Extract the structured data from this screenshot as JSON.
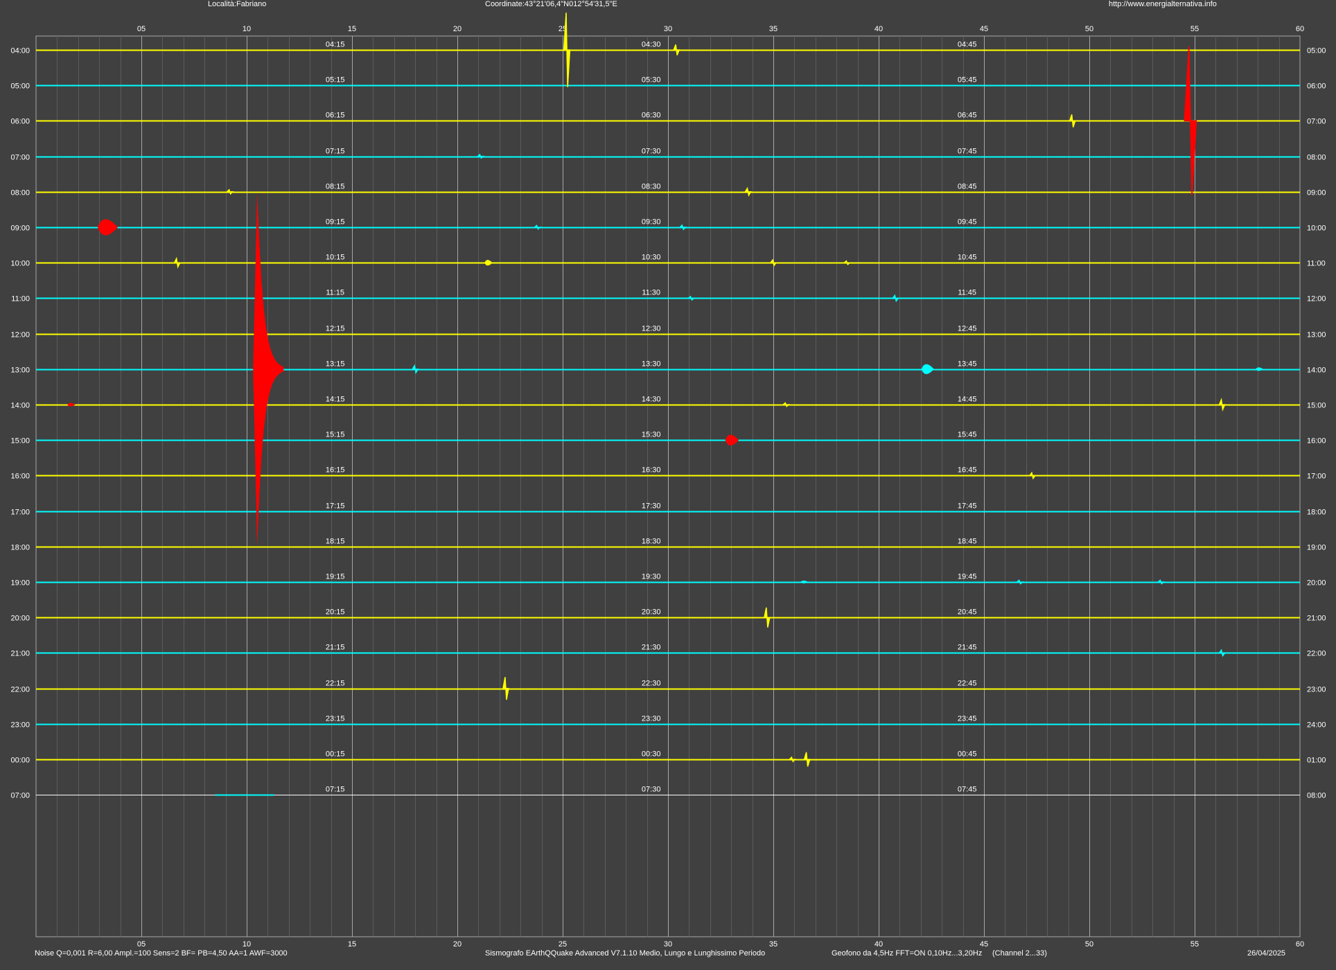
{
  "header": {
    "location": "Località:Fabriano",
    "coordinates": "Coordinate:43°21'06,4\"N012°54'31,5\"E",
    "url": "http://www.energialternativa.info"
  },
  "footer": {
    "noise": "Noise Q=0,001 R=6,00 Ampl.=100 Sens=2 BF= PB=4,50 AA=1 AWF=3000",
    "software": "Sismografo  EArthQQuake Advanced V7.1.10  Medio, Lungo e Lunghissimo Periodo",
    "geophone": "Geofono da 4,5Hz FFT=ON 0,10Hz...3,20Hz",
    "channel": "(Channel 2...33)",
    "date": "26/04/2025"
  },
  "colors": {
    "background": "#404040",
    "yellow_trace": "#ffff00",
    "cyan_trace": "#00ffff",
    "event": "#ff0000",
    "white_trace": "#ffffff",
    "major_grid": "#a8a8a8",
    "minor_grid": "#5c5c5c"
  },
  "chart_data": {
    "type": "line",
    "title": "",
    "x_unit": "minutes",
    "xlim": [
      0,
      60
    ],
    "x_tick_labels": [
      "05",
      "10",
      "15",
      "20",
      "25",
      "30",
      "35",
      "40",
      "45",
      "50",
      "55",
      "60"
    ],
    "grid": true,
    "rows": [
      {
        "left": "04:00",
        "right": "05:00",
        "q": [
          "04:15",
          "04:30",
          "04:45"
        ],
        "color": "yellow"
      },
      {
        "left": "05:00",
        "right": "06:00",
        "q": [
          "05:15",
          "05:30",
          "05:45"
        ],
        "color": "cyan"
      },
      {
        "left": "06:00",
        "right": "07:00",
        "q": [
          "06:15",
          "06:30",
          "06:45"
        ],
        "color": "yellow"
      },
      {
        "left": "07:00",
        "right": "08:00",
        "q": [
          "07:15",
          "07:30",
          "07:45"
        ],
        "color": "cyan"
      },
      {
        "left": "08:00",
        "right": "09:00",
        "q": [
          "08:15",
          "08:30",
          "08:45"
        ],
        "color": "yellow"
      },
      {
        "left": "09:00",
        "right": "10:00",
        "q": [
          "09:15",
          "09:30",
          "09:45"
        ],
        "color": "cyan"
      },
      {
        "left": "10:00",
        "right": "11:00",
        "q": [
          "10:15",
          "10:30",
          "10:45"
        ],
        "color": "yellow"
      },
      {
        "left": "11:00",
        "right": "12:00",
        "q": [
          "11:15",
          "11:30",
          "11:45"
        ],
        "color": "cyan"
      },
      {
        "left": "12:00",
        "right": "13:00",
        "q": [
          "12:15",
          "12:30",
          "12:45"
        ],
        "color": "yellow"
      },
      {
        "left": "13:00",
        "right": "14:00",
        "q": [
          "13:15",
          "13:30",
          "13:45"
        ],
        "color": "cyan"
      },
      {
        "left": "14:00",
        "right": "15:00",
        "q": [
          "14:15",
          "14:30",
          "14:45"
        ],
        "color": "yellow"
      },
      {
        "left": "15:00",
        "right": "16:00",
        "q": [
          "15:15",
          "15:30",
          "15:45"
        ],
        "color": "cyan"
      },
      {
        "left": "16:00",
        "right": "17:00",
        "q": [
          "16:15",
          "16:30",
          "16:45"
        ],
        "color": "yellow"
      },
      {
        "left": "17:00",
        "right": "18:00",
        "q": [
          "17:15",
          "17:30",
          "17:45"
        ],
        "color": "cyan"
      },
      {
        "left": "18:00",
        "right": "19:00",
        "q": [
          "18:15",
          "18:30",
          "18:45"
        ],
        "color": "yellow"
      },
      {
        "left": "19:00",
        "right": "20:00",
        "q": [
          "19:15",
          "19:30",
          "19:45"
        ],
        "color": "cyan"
      },
      {
        "left": "20:00",
        "right": "21:00",
        "q": [
          "20:15",
          "20:30",
          "20:45"
        ],
        "color": "yellow"
      },
      {
        "left": "21:00",
        "right": "22:00",
        "q": [
          "21:15",
          "21:30",
          "21:45"
        ],
        "color": "cyan"
      },
      {
        "left": "22:00",
        "right": "23:00",
        "q": [
          "22:15",
          "22:30",
          "22:45"
        ],
        "color": "yellow"
      },
      {
        "left": "23:00",
        "right": "24:00",
        "q": [
          "23:15",
          "23:30",
          "23:45"
        ],
        "color": "cyan"
      },
      {
        "left": "00:00",
        "right": "01:00",
        "q": [
          "00:15",
          "00:30",
          "00:45"
        ],
        "color": "yellow"
      },
      {
        "left": "07:00",
        "right": "08:00",
        "q": [
          "07:15",
          "07:30",
          "07:45"
        ],
        "color": "white"
      }
    ],
    "events": [
      {
        "row": 0,
        "minute": 25.2,
        "amp": 1.05,
        "color": "yellow",
        "kind": "spike"
      },
      {
        "row": 0,
        "minute": 30.4,
        "amp": 0.15,
        "color": "yellow",
        "kind": "spike"
      },
      {
        "row": 2,
        "minute": 54.8,
        "amp": 2.1,
        "color": "red",
        "kind": "spike"
      },
      {
        "row": 2,
        "minute": 49.2,
        "amp": 0.18,
        "color": "yellow",
        "kind": "spike"
      },
      {
        "row": 3,
        "minute": 21.1,
        "amp": 0.05,
        "color": "cyan",
        "kind": "spike"
      },
      {
        "row": 4,
        "minute": 9.2,
        "amp": 0.06,
        "color": "yellow",
        "kind": "spike"
      },
      {
        "row": 4,
        "minute": 33.8,
        "amp": 0.1,
        "color": "yellow",
        "kind": "spike"
      },
      {
        "row": 5,
        "minute": 3.2,
        "amp": 0.45,
        "color": "red",
        "kind": "burst"
      },
      {
        "row": 5,
        "minute": 23.8,
        "amp": 0.05,
        "color": "cyan",
        "kind": "spike"
      },
      {
        "row": 5,
        "minute": 30.7,
        "amp": 0.06,
        "color": "cyan",
        "kind": "spike"
      },
      {
        "row": 6,
        "minute": 6.7,
        "amp": 0.12,
        "color": "yellow",
        "kind": "spike"
      },
      {
        "row": 6,
        "minute": 21.4,
        "amp": 0.16,
        "color": "yellow",
        "kind": "burst"
      },
      {
        "row": 6,
        "minute": 35.0,
        "amp": 0.08,
        "color": "yellow",
        "kind": "spike"
      },
      {
        "row": 6,
        "minute": 38.5,
        "amp": 0.05,
        "color": "yellow",
        "kind": "spike"
      },
      {
        "row": 7,
        "minute": 31.1,
        "amp": 0.05,
        "color": "cyan",
        "kind": "spike"
      },
      {
        "row": 7,
        "minute": 40.8,
        "amp": 0.08,
        "color": "cyan",
        "kind": "spike"
      },
      {
        "row": 9,
        "minute": 10.5,
        "amp": 5.0,
        "color": "red",
        "kind": "quake"
      },
      {
        "row": 9,
        "minute": 18.0,
        "amp": 0.1,
        "color": "cyan",
        "kind": "spike"
      },
      {
        "row": 9,
        "minute": 42.2,
        "amp": 0.28,
        "color": "cyan",
        "kind": "burst"
      },
      {
        "row": 9,
        "minute": 58.0,
        "amp": 0.1,
        "color": "cyan",
        "kind": "burst"
      },
      {
        "row": 10,
        "minute": 1.6,
        "amp": 0.1,
        "color": "red",
        "kind": "burst"
      },
      {
        "row": 10,
        "minute": 56.3,
        "amp": 0.14,
        "color": "yellow",
        "kind": "spike"
      },
      {
        "row": 10,
        "minute": 35.6,
        "amp": 0.05,
        "color": "yellow",
        "kind": "spike"
      },
      {
        "row": 11,
        "minute": 32.9,
        "amp": 0.3,
        "color": "red",
        "kind": "burst"
      },
      {
        "row": 12,
        "minute": 47.3,
        "amp": 0.08,
        "color": "yellow",
        "kind": "spike"
      },
      {
        "row": 15,
        "minute": 36.4,
        "amp": 0.08,
        "color": "cyan",
        "kind": "burst"
      },
      {
        "row": 15,
        "minute": 46.7,
        "amp": 0.05,
        "color": "cyan",
        "kind": "spike"
      },
      {
        "row": 15,
        "minute": 53.4,
        "amp": 0.05,
        "color": "cyan",
        "kind": "spike"
      },
      {
        "row": 16,
        "minute": 34.7,
        "amp": 0.28,
        "color": "yellow",
        "kind": "spike"
      },
      {
        "row": 17,
        "minute": 56.3,
        "amp": 0.08,
        "color": "cyan",
        "kind": "spike"
      },
      {
        "row": 18,
        "minute": 22.3,
        "amp": 0.32,
        "color": "yellow",
        "kind": "spike"
      },
      {
        "row": 20,
        "minute": 36.6,
        "amp": 0.2,
        "color": "yellow",
        "kind": "spike"
      },
      {
        "row": 20,
        "minute": 35.9,
        "amp": 0.06,
        "color": "yellow",
        "kind": "spike"
      }
    ],
    "partial_trace": {
      "row": 21,
      "x_start": 8.5,
      "x_end": 11.3,
      "color": "cyan"
    }
  }
}
